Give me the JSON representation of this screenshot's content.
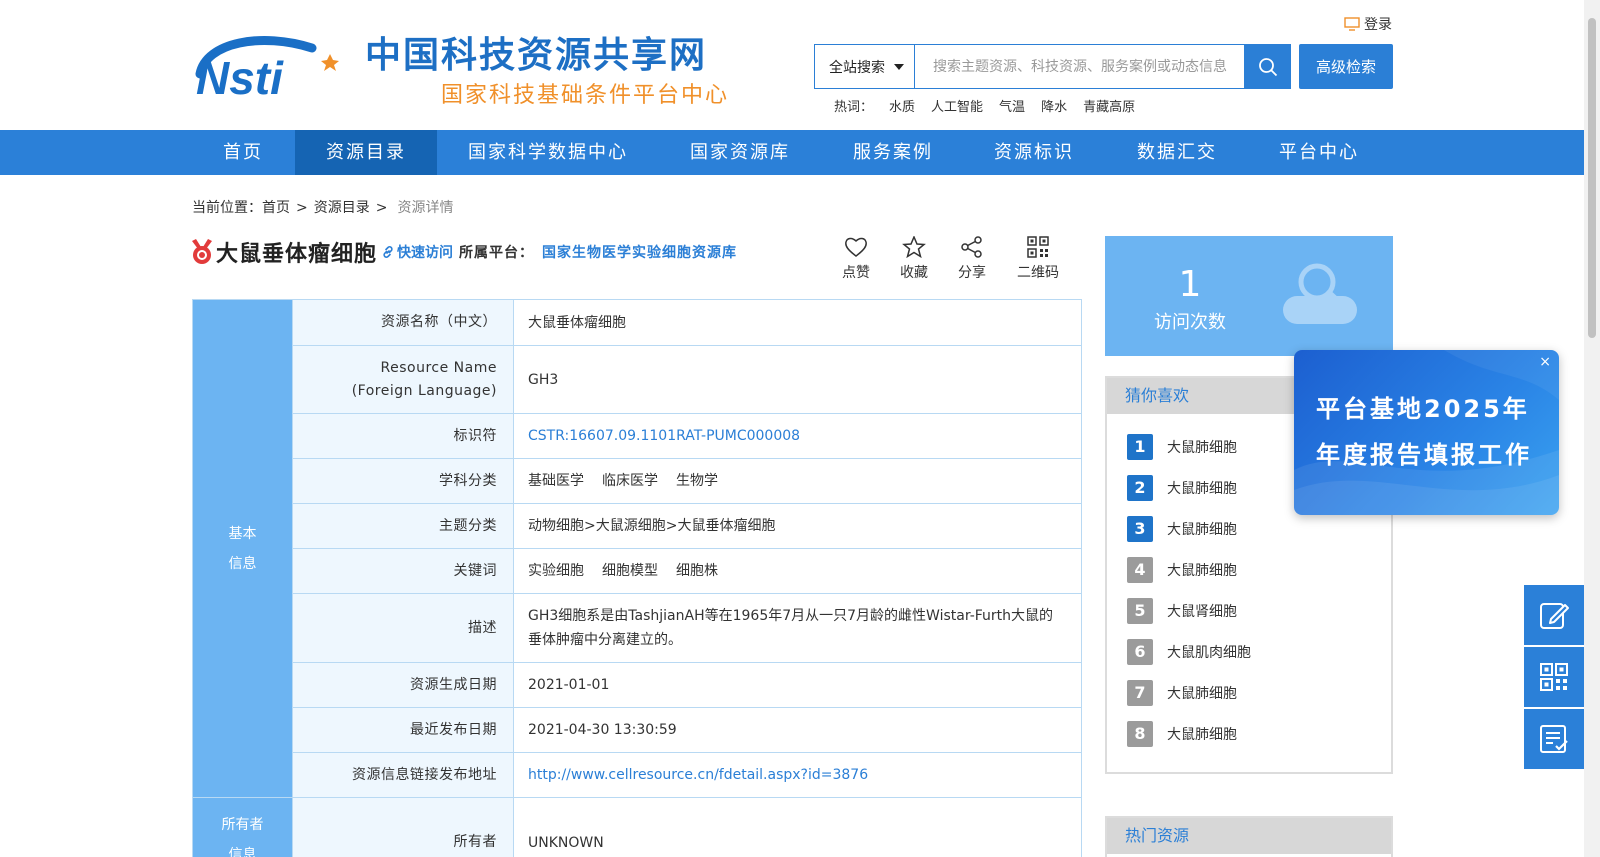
{
  "header": {
    "logo_text": "Nsti",
    "title": "中国科技资源共享网",
    "subtitle": "国家科技基础条件平台中心",
    "login_label": "登录"
  },
  "search": {
    "scope": "全站搜索",
    "placeholder": "搜索主题资源、科技资源、服务案例或动态信息",
    "advanced_label": "高级检索",
    "hot_label": "热词：",
    "hot_words": [
      "水质",
      "人工智能",
      "气温",
      "降水",
      "青藏高原"
    ]
  },
  "nav": {
    "items": [
      "首页",
      "资源目录",
      "国家科学数据中心",
      "国家资源库",
      "服务案例",
      "资源标识",
      "数据汇交",
      "平台中心"
    ],
    "active": "资源目录"
  },
  "breadcrumb": {
    "prefix": "当前位置：",
    "items": [
      "首页",
      "资源目录"
    ],
    "current": "资源详情"
  },
  "resource": {
    "title": "大鼠垂体瘤细胞",
    "quick_access": "快速访问",
    "platform_label": "所属平台：",
    "platform_value": "国家生物医学实验细胞资源库",
    "actions": [
      "点赞",
      "收藏",
      "分享",
      "二维码"
    ]
  },
  "info_table": {
    "section_basic": [
      "基本",
      "信息"
    ],
    "section_owner": [
      "所有者",
      "信息"
    ],
    "rows": [
      {
        "label": "资源名称（中文）",
        "value": "大鼠垂体瘤细胞"
      },
      {
        "label_line1": "Resource Name",
        "label_line2": "(Foreign Language)",
        "value": "GH3"
      },
      {
        "label": "标识符",
        "value": "CSTR:16607.09.1101RAT-PUMC000008"
      },
      {
        "label": "学科分类",
        "tags": [
          "基础医学",
          "临床医学",
          "生物学"
        ]
      },
      {
        "label": "主题分类",
        "value": "动物细胞>大鼠源细胞>大鼠垂体瘤细胞"
      },
      {
        "label": "关键词",
        "tags": [
          "实验细胞",
          "细胞模型",
          "细胞株"
        ]
      },
      {
        "label": "描述",
        "value": "GH3细胞系是由TashjianAH等在1965年7月从一只7月龄的雌性Wistar-Furth大鼠的垂体肿瘤中分离建立的。"
      },
      {
        "label": "资源生成日期",
        "value": "2021-01-01"
      },
      {
        "label": "最近发布日期",
        "value": "2021-04-30 13:30:59"
      },
      {
        "label": "资源信息链接发布地址",
        "value": "http://www.cellresource.cn/fdetail.aspx?id=3876"
      },
      {
        "label": "所有者",
        "value": "UNKNOWN"
      }
    ]
  },
  "visits": {
    "count": "1",
    "label": "访问次数"
  },
  "guess": {
    "title": "猜你喜欢",
    "items": [
      {
        "rank": "1",
        "name": "大鼠肺细胞"
      },
      {
        "rank": "2",
        "name": "大鼠肺细胞"
      },
      {
        "rank": "3",
        "name": "大鼠肺细胞"
      },
      {
        "rank": "4",
        "name": "大鼠肺细胞"
      },
      {
        "rank": "5",
        "name": "大鼠肾细胞"
      },
      {
        "rank": "6",
        "name": "大鼠肌肉细胞"
      },
      {
        "rank": "7",
        "name": "大鼠肺细胞"
      },
      {
        "rank": "8",
        "name": "大鼠肺细胞"
      }
    ]
  },
  "hot_resources": {
    "title": "热门资源"
  },
  "popup": {
    "line1": "平台基地2025年",
    "line2": "年度报告填报工作",
    "close": "×"
  },
  "side_tools": [
    "edit-icon",
    "qrcode-icon",
    "checklist-icon"
  ],
  "colors": {
    "primary": "#2b80d8",
    "nav_active": "#1564b3",
    "light_blue": "#6cb4f2",
    "orange": "#f0902a"
  }
}
